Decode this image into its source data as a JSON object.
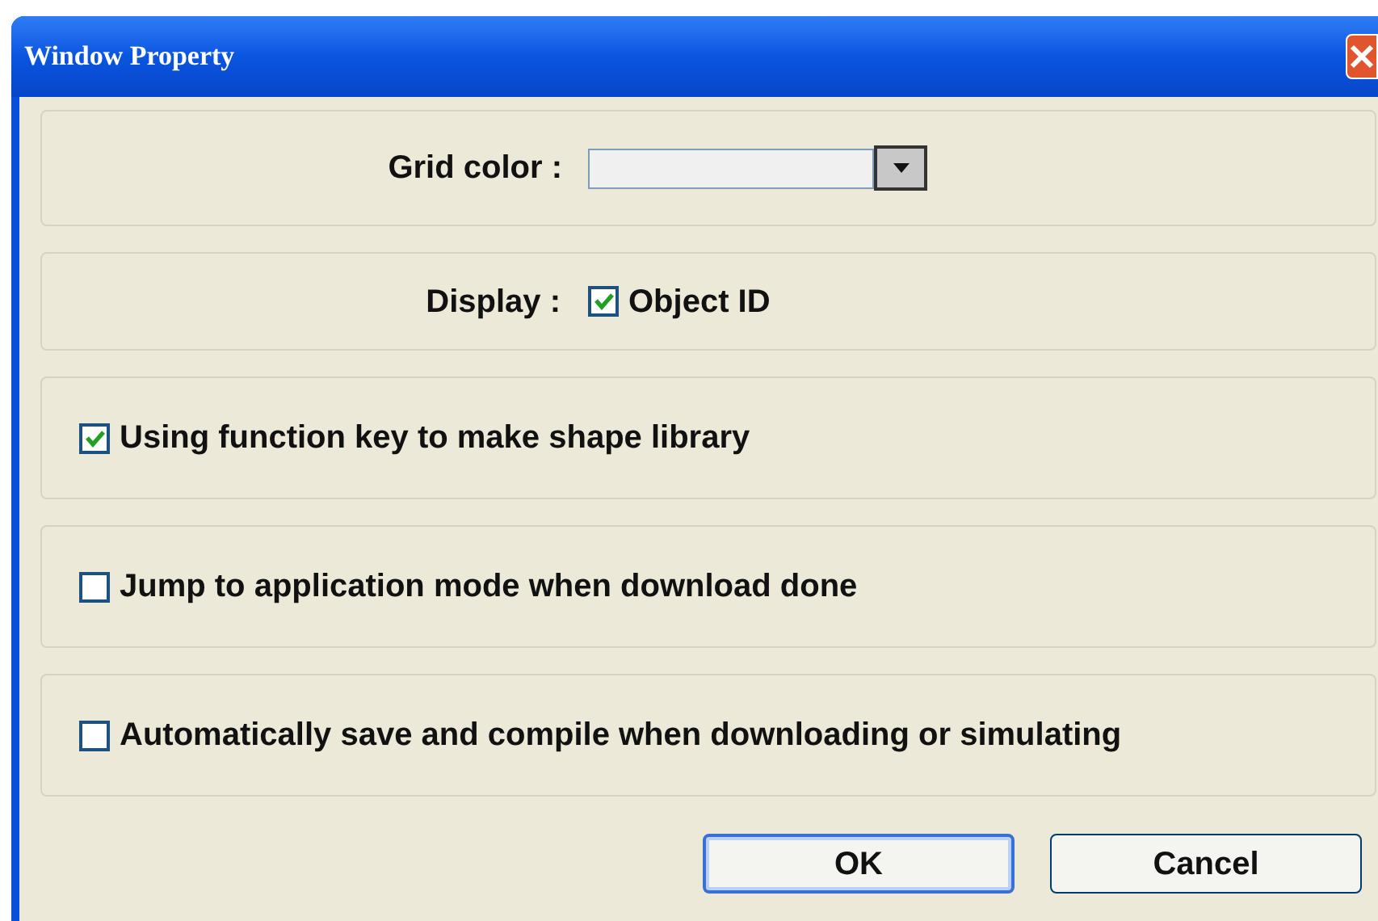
{
  "window": {
    "title": "Window Property"
  },
  "grid_color": {
    "label": "Grid color :"
  },
  "display": {
    "label": "Display :",
    "option": {
      "label": "Object ID",
      "checked": true
    }
  },
  "options": [
    {
      "label": "Using function key to make shape library",
      "checked": true
    },
    {
      "label": "Jump to application mode when download done",
      "checked": false
    },
    {
      "label": "Automatically save and compile when downloading or simulating",
      "checked": false
    }
  ],
  "buttons": [
    {
      "label": "OK",
      "default": true
    },
    {
      "label": "Cancel",
      "default": false
    }
  ]
}
